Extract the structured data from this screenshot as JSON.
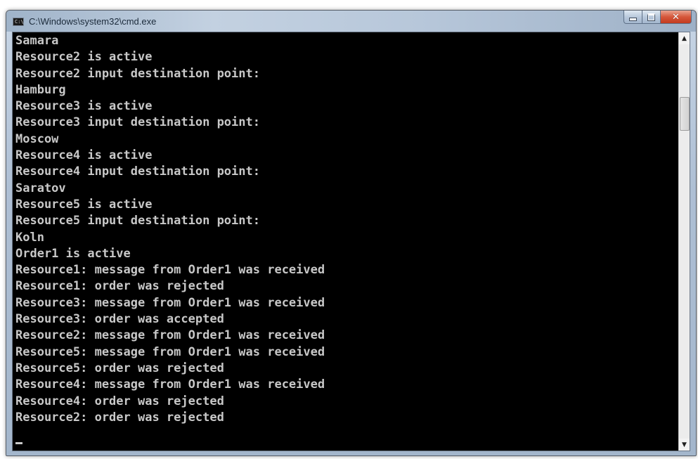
{
  "window": {
    "title": "C:\\Windows\\system32\\cmd.exe",
    "icon": "console-icon",
    "icon_glyph": "C:\\",
    "buttons": {
      "minimize_icon": "minimize-icon",
      "maximize_icon": "maximize-icon",
      "close_icon": "close-icon",
      "close_glyph": "✕"
    }
  },
  "console": {
    "background": "#000000",
    "text_color": "#c8c8c8",
    "lines": [
      "Samara",
      "Resource2 is active",
      "Resource2 input destination point:",
      "Hamburg",
      "Resource3 is active",
      "Resource3 input destination point:",
      "Moscow",
      "Resource4 is active",
      "Resource4 input destination point:",
      "Saratov",
      "Resource5 is active",
      "Resource5 input destination point:",
      "Koln",
      "Order1 is active",
      "Resource1: message from Order1 was received",
      "Resource1: order was rejected",
      "Resource3: message from Order1 was received",
      "Resource3: order was accepted",
      "Resource2: message from Order1 was received",
      "Resource5: message from Order1 was received",
      "Resource5: order was rejected",
      "Resource4: message from Order1 was received",
      "Resource4: order was rejected",
      "Resource2: order was rejected"
    ]
  },
  "scrollbar": {
    "up_glyph": "▲",
    "down_glyph": "▼"
  },
  "colors": {
    "close_button": "#c33b1f",
    "titlebar": "#b7c7da"
  }
}
